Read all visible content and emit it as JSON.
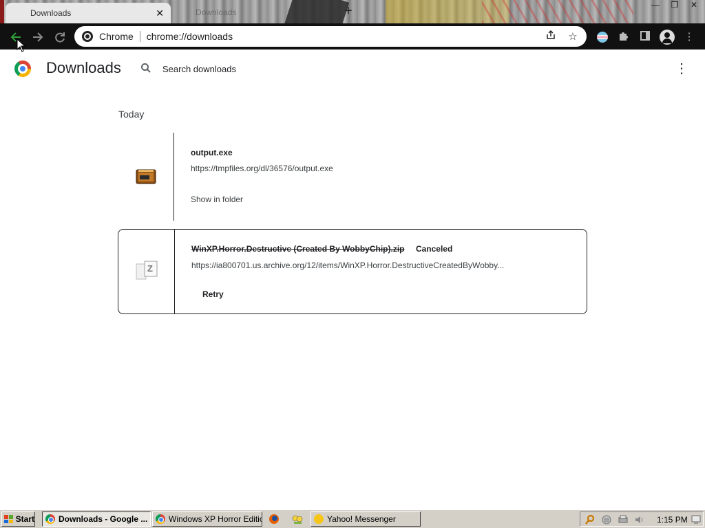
{
  "browser": {
    "active_tab_title": "Downloads",
    "inactive_tab_title": "Downloads",
    "new_tab_label": "+",
    "omnibox_site": "Chrome",
    "omnibox_url": "chrome://downloads"
  },
  "downloads_page": {
    "title": "Downloads",
    "search_placeholder": "Search downloads",
    "section_date": "Today",
    "items": [
      {
        "file_name": "output.exe",
        "url": "https://tmpfiles.org/dl/36576/output.exe",
        "action": "Show in folder",
        "icon": "exe-file-icon"
      },
      {
        "file_name": "WinXP.Horror.Destructive (Created By WobbyChip).zip",
        "status": "Canceled",
        "url": "https://ia800701.us.archive.org/12/items/WinXP.Horror.DestructiveCreatedByWobby...",
        "action": "Retry",
        "icon": "zip-file-icon"
      }
    ]
  },
  "taskbar": {
    "start_label": "Start",
    "buttons": [
      {
        "label": "Downloads - Google ...",
        "active": true,
        "icon": "chrome-icon"
      },
      {
        "label": "Windows XP Horror Editio...",
        "active": false,
        "icon": "chrome-icon"
      },
      {
        "label": "Yahoo! Messenger",
        "active": false,
        "icon": "yahoo-messenger-icon"
      }
    ],
    "clock": "1:15 PM"
  },
  "colors": {
    "back_arrow": "#2e9c3a",
    "toolbar_bg": "#111111",
    "taskbar_bg": "#d4d0c8"
  }
}
